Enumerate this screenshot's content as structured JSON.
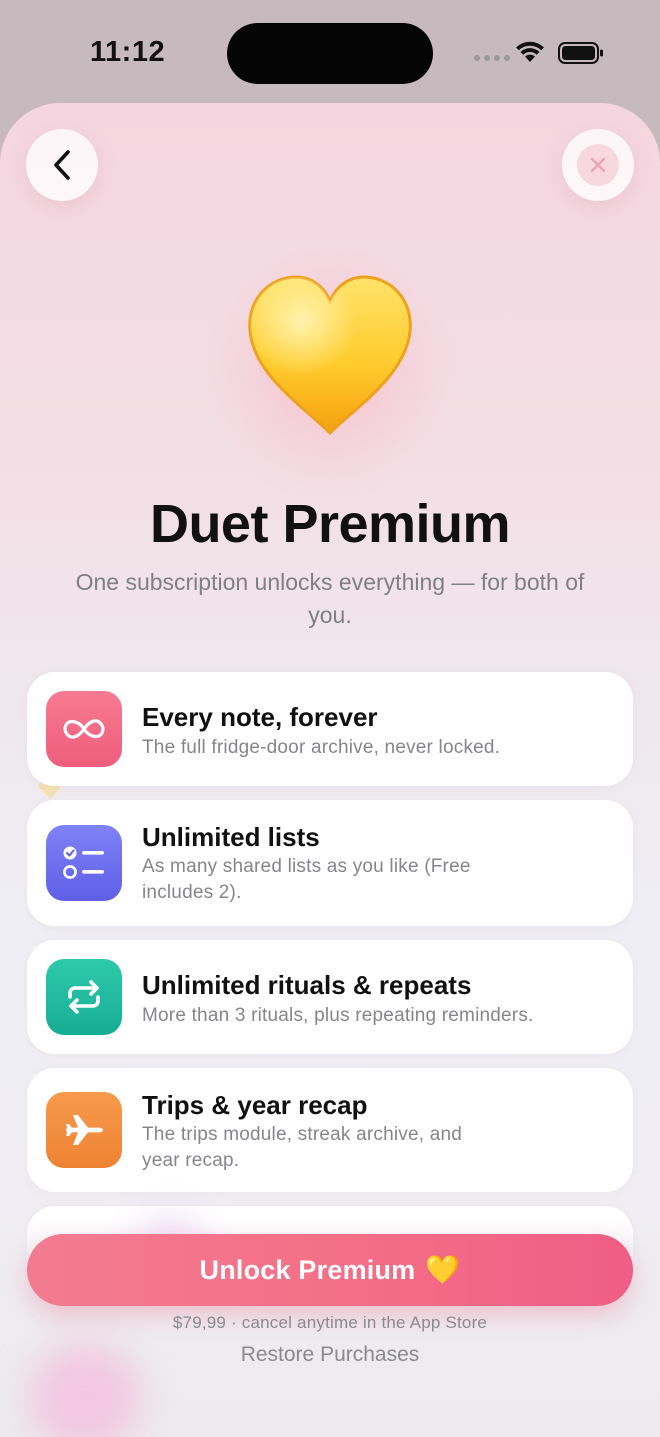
{
  "status_bar": {
    "time": "11:12"
  },
  "header": {
    "back_icon": "chevron-left-icon",
    "close_icon": "close-icon",
    "hero_icon": "yellow-heart-icon"
  },
  "hero": {
    "title": "Duet Premium",
    "subtitle": "One subscription unlocks everything — for both of you."
  },
  "features": [
    {
      "title": "Every note, forever",
      "description": "The full fridge-door archive, never locked.",
      "icon": "infinity-icon",
      "color": "#f26b86"
    },
    {
      "title": "Unlimited lists",
      "description": "As many shared lists as you like (Free includes 2).",
      "icon": "checklist-icon",
      "color": "#6b6cf0"
    },
    {
      "title": "Unlimited rituals & repeats",
      "description": "More than 3 rituals, plus repeating reminders.",
      "icon": "repeat-icon",
      "color": "#20b9a0"
    },
    {
      "title": "Trips & year recap",
      "description": "The trips module, streak archive, and year recap.",
      "icon": "airplane-icon",
      "color": "#f08a3c"
    }
  ],
  "cta": {
    "label": "Unlock Premium",
    "emoji": "💛",
    "color": "#f4738b",
    "price_line": "$79,99 · cancel anytime in the App Store",
    "restore_label": "Restore Purchases"
  }
}
